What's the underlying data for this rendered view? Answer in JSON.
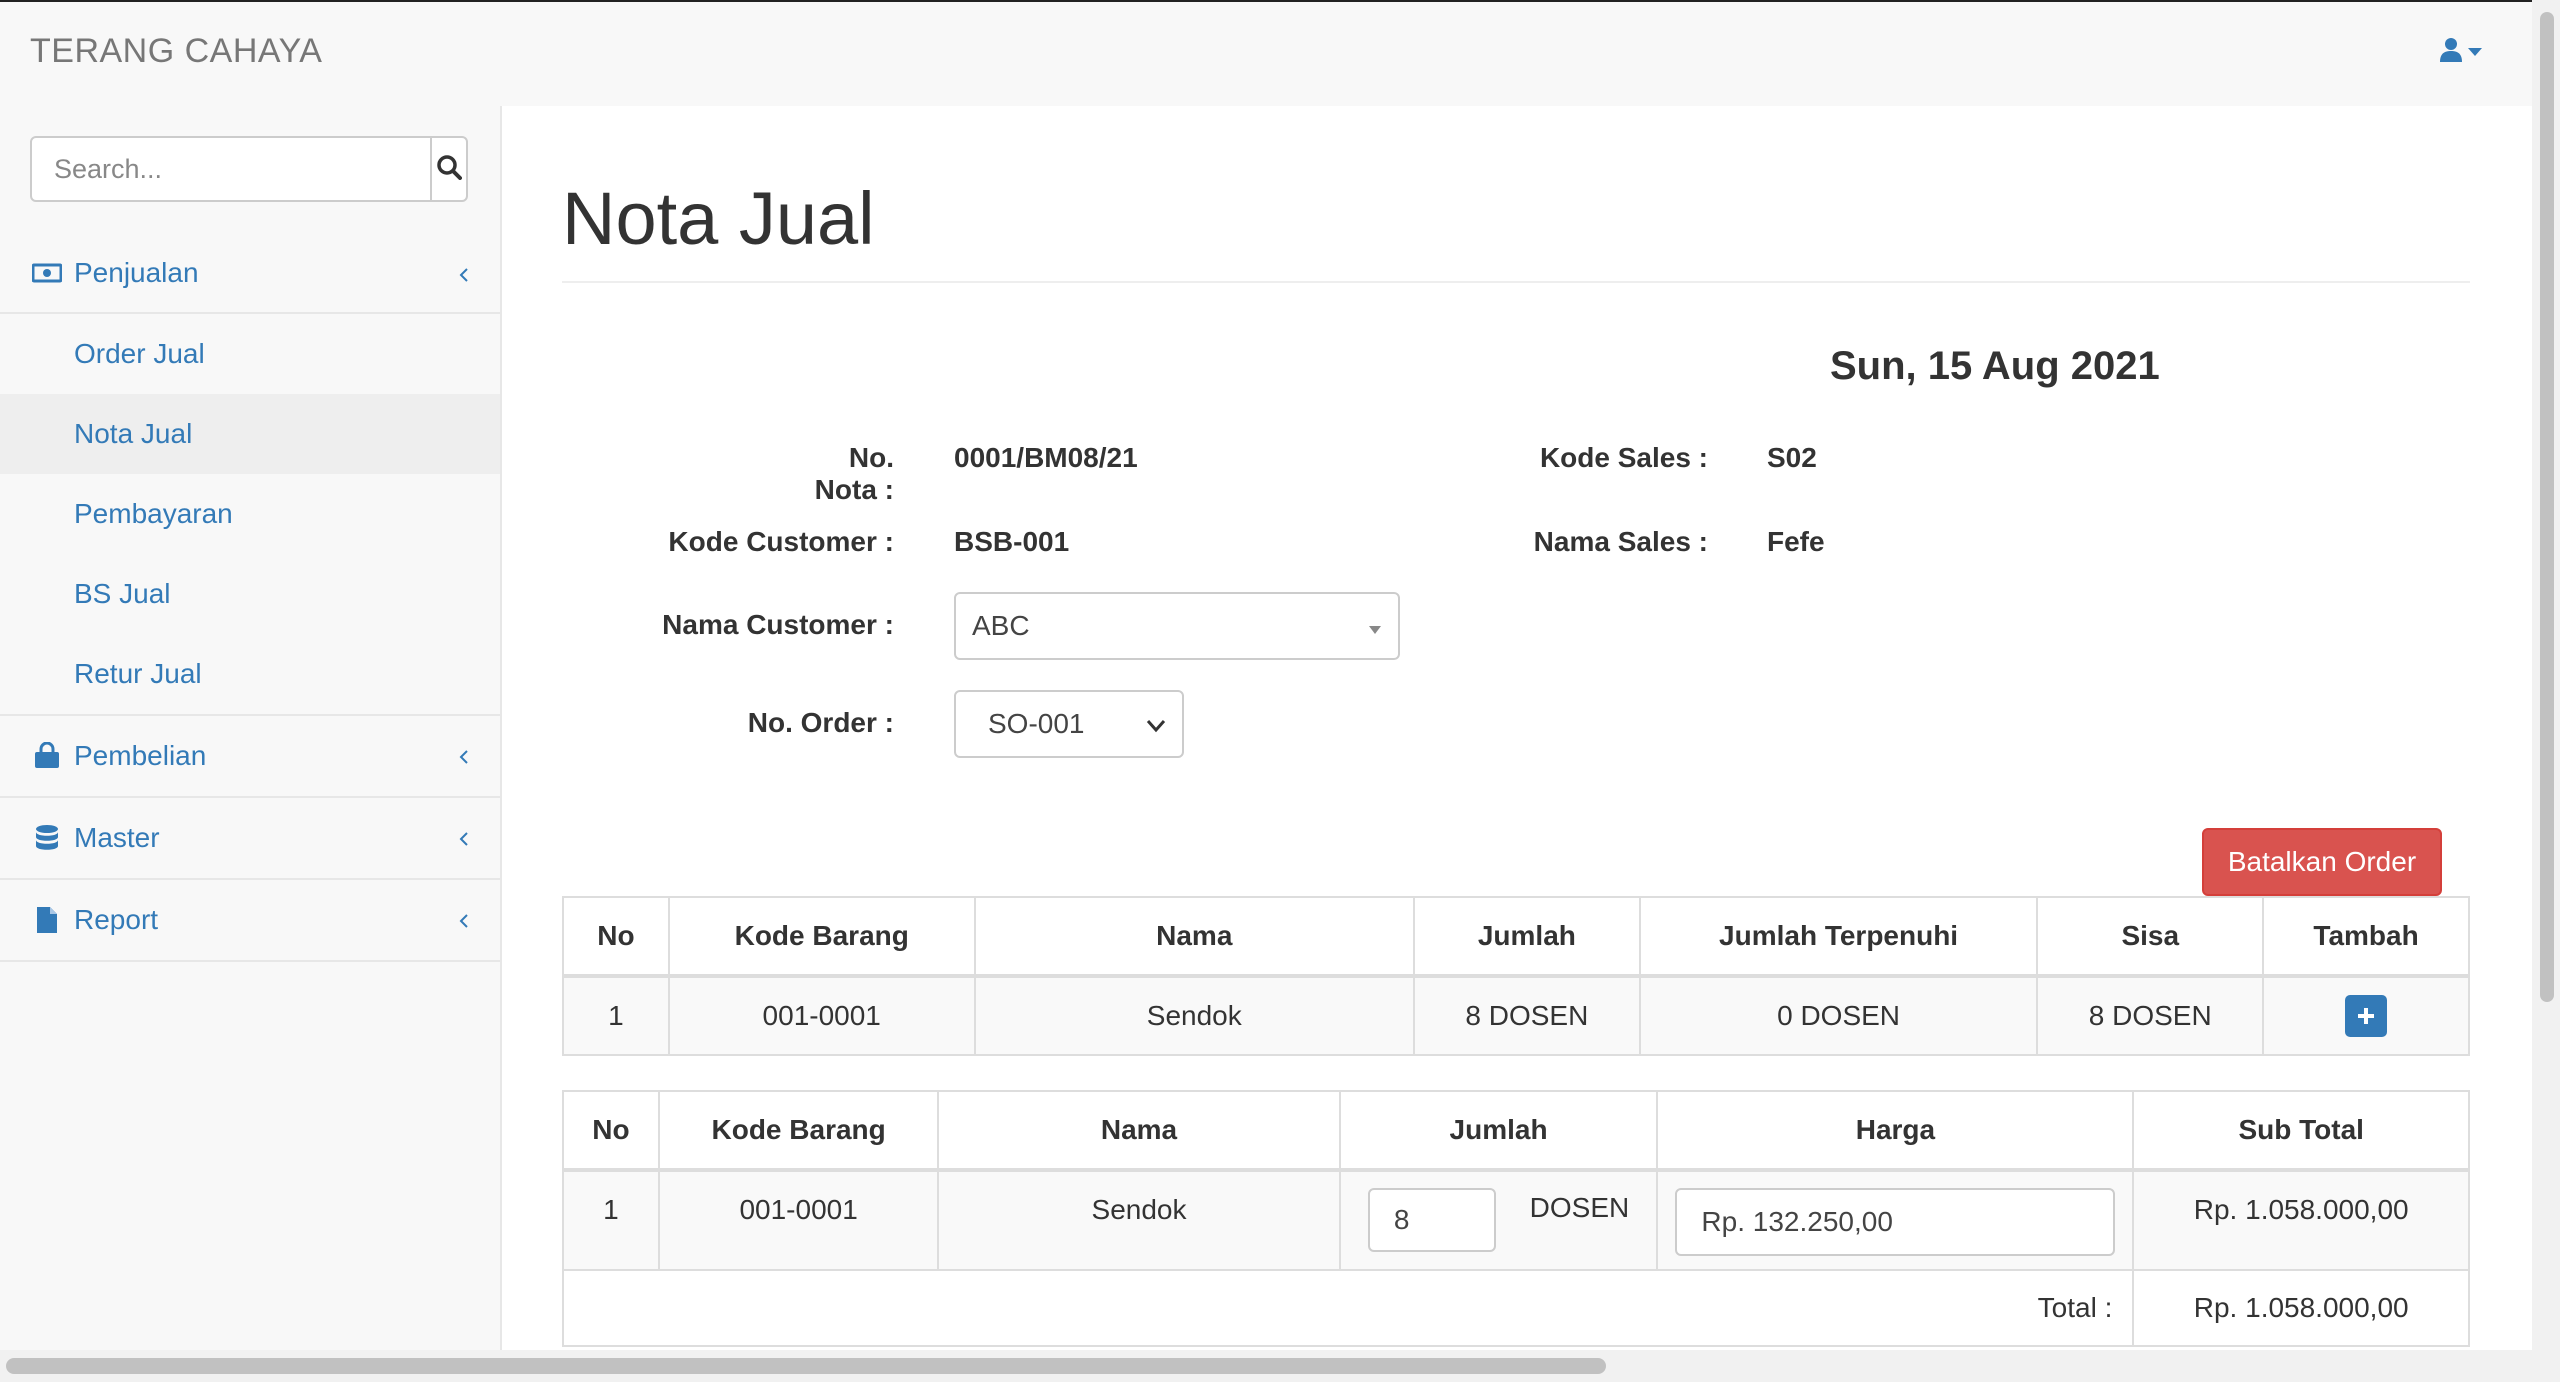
{
  "brand": "TERANG CAHAYA",
  "search": {
    "placeholder": "Search..."
  },
  "sidebar": {
    "penjualan": {
      "label": "Penjualan",
      "items": [
        "Order Jual",
        "Nota Jual",
        "Pembayaran",
        "BS Jual",
        "Retur Jual"
      ],
      "active": "Nota Jual"
    },
    "pembelian": {
      "label": "Pembelian"
    },
    "master": {
      "label": "Master"
    },
    "report": {
      "label": "Report"
    }
  },
  "page": {
    "title": "Nota Jual",
    "date": "Sun, 15 Aug 2021"
  },
  "form": {
    "no_nota_label": "No. Nota :",
    "no_nota_value": "0001/BM08/21",
    "kode_customer_label": "Kode Customer :",
    "kode_customer_value": "BSB-001",
    "nama_customer_label": "Nama Customer :",
    "nama_customer_value": "ABC",
    "no_order_label": "No. Order :",
    "no_order_value": "SO-001",
    "kode_sales_label": "Kode Sales :",
    "kode_sales_value": "S02",
    "nama_sales_label": "Nama Sales :",
    "nama_sales_value": "Fefe"
  },
  "batalkan_label": "Batalkan Order",
  "order_table": {
    "headers": [
      "No",
      "Kode Barang",
      "Nama",
      "Jumlah",
      "Jumlah Terpenuhi",
      "Sisa",
      "Tambah"
    ],
    "rows": [
      {
        "no": "1",
        "kode": "001-0001",
        "nama": "Sendok",
        "jumlah": "8 DOSEN",
        "terpenuhi": "0 DOSEN",
        "sisa": "8 DOSEN"
      }
    ]
  },
  "nota_table": {
    "headers": [
      "No",
      "Kode Barang",
      "Nama",
      "Jumlah",
      "Harga",
      "Sub Total"
    ],
    "rows": [
      {
        "no": "1",
        "kode": "001-0001",
        "nama": "Sendok",
        "qty": "8",
        "unit": "DOSEN",
        "harga": "Rp. 132.250,00",
        "subtotal": "Rp. 1.058.000,00"
      }
    ],
    "total_label": "Total :",
    "total_value": "Rp. 1.058.000,00"
  },
  "colors": {
    "link": "#337ab7",
    "danger": "#d9534f"
  },
  "icons": {
    "user": "user-icon",
    "search": "search-icon",
    "penjualan": "money-icon",
    "pembelian": "shopping-bag-icon",
    "master": "database-icon",
    "report": "file-icon"
  }
}
